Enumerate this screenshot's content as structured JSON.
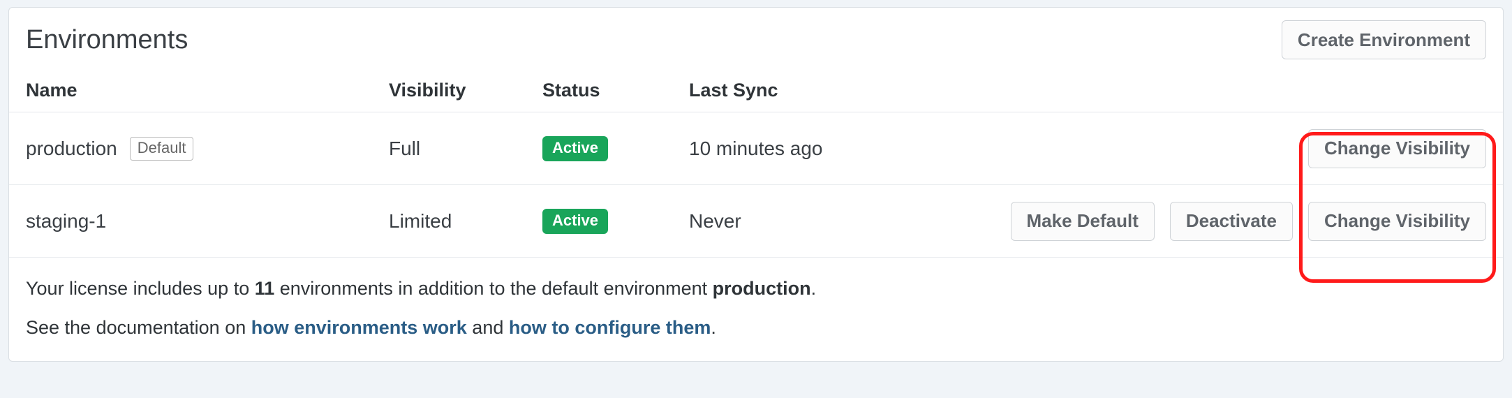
{
  "header": {
    "title": "Environments",
    "create_button": "Create Environment"
  },
  "columns": {
    "name": "Name",
    "visibility": "Visibility",
    "status": "Status",
    "last_sync": "Last Sync"
  },
  "rows": [
    {
      "name": "production",
      "default_badge": "Default",
      "visibility": "Full",
      "status": "Active",
      "last_sync": "10 minutes ago",
      "actions": {
        "change_visibility": "Change Visibility"
      }
    },
    {
      "name": "staging-1",
      "visibility": "Limited",
      "status": "Active",
      "last_sync": "Never",
      "actions": {
        "make_default": "Make Default",
        "deactivate": "Deactivate",
        "change_visibility": "Change Visibility"
      }
    }
  ],
  "footer": {
    "line1_prefix": "Your license includes up to ",
    "line1_count": "11",
    "line1_mid": " environments in addition to the default environment ",
    "line1_env": "production",
    "line1_suffix": ".",
    "line2_prefix": "See the documentation on ",
    "line2_link1": "how environments work",
    "line2_mid": " and ",
    "line2_link2": "how to configure them",
    "line2_suffix": "."
  },
  "highlight": {
    "note": "red annotation box surrounding the Change Visibility buttons column"
  }
}
